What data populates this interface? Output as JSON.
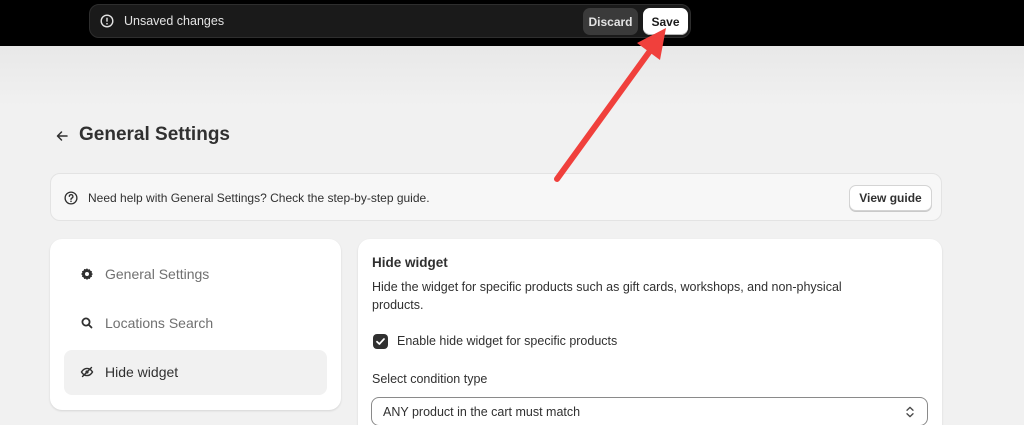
{
  "save_bar": {
    "message": "Unsaved changes",
    "discard_label": "Discard",
    "save_label": "Save"
  },
  "header": {
    "title": "General Settings"
  },
  "help_banner": {
    "text": "Need help with General Settings? Check the step-by-step guide.",
    "button_label": "View guide"
  },
  "sidebar": {
    "items": [
      {
        "label": "General Settings",
        "icon": "gear-icon"
      },
      {
        "label": "Locations Search",
        "icon": "search-icon"
      },
      {
        "label": "Hide widget",
        "icon": "eye-slash-icon",
        "active": true
      }
    ]
  },
  "hide_widget": {
    "title": "Hide widget",
    "description": "Hide the widget for specific products such as gift cards, workshops, and non-physical products.",
    "checkbox_label": "Enable hide widget for specific products",
    "checkbox_checked": true,
    "condition_label": "Select condition type",
    "condition_value": "ANY product in the cart must match"
  },
  "colors": {
    "annotation_arrow": "#f0403c",
    "top_bar": "#000000",
    "page_bg": "#f1f1f1"
  }
}
